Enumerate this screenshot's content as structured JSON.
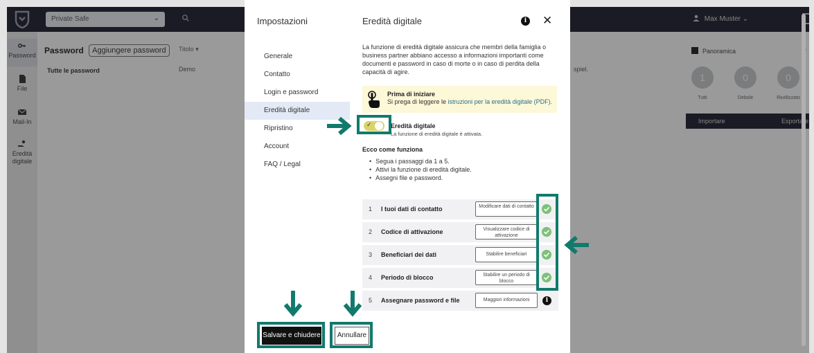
{
  "app": {
    "safe_selector": "Private Safe",
    "user_name": "Max Muster",
    "nav": [
      {
        "label": "Password"
      },
      {
        "label": "File"
      },
      {
        "label": "Mail-In"
      },
      {
        "label": "Eredità digitale"
      }
    ],
    "list_title": "Password",
    "add_password_label": "Aggiungere password",
    "all_passwords_label": "Tutte le password",
    "column_title": "Titolo",
    "row_title": "Demo",
    "row_note_fragment": "spiel.",
    "overview": {
      "title": "Panoramica",
      "more": "»",
      "counts": [
        {
          "value": "1",
          "label": "Tutti"
        },
        {
          "value": "0",
          "label": "Debole"
        },
        {
          "value": "0",
          "label": "Riutilizzato"
        }
      ],
      "import_label": "Importare",
      "export_label": "Esportare"
    }
  },
  "modal": {
    "left_title": "Impostazioni",
    "menu": [
      {
        "label": "Generale",
        "active": false
      },
      {
        "label": "Contatto",
        "active": false
      },
      {
        "label": "Login e password",
        "active": false
      },
      {
        "label": "Eredità digitale",
        "active": true
      },
      {
        "label": "Ripristino",
        "active": false
      },
      {
        "label": "Account",
        "active": false
      },
      {
        "label": "FAQ / Legal",
        "active": false
      }
    ],
    "right_title": "Eredità digitale",
    "info_glyph": "i",
    "close_glyph": "✕",
    "intro": "La funzione di eredità digitale assicura che membri della famiglia o business partner abbiano accesso a informazioni importanti come documenti e password in caso di morte o in caso di perdita della capacità di agire.",
    "prima": {
      "title": "Prima di iniziare",
      "text_before": "Si prega di leggere le ",
      "link": "istruzioni per la eredità digitale (PDF).",
      "icon": "hand-pointer-icon"
    },
    "toggle": {
      "title": "Eredità digitale",
      "subtitle": "La funzione di eredità digitale è attivata.",
      "state": "on",
      "check": "✓"
    },
    "how_title": "Ecco come funziona",
    "bullets": [
      "Segua i passaggi da 1 a 5.",
      "Attivi la funzione di eredità digitale.",
      "Assegni file e password."
    ],
    "steps": [
      {
        "num": "1",
        "label": "I tuoi dati di contatto",
        "button": "Modificare dati di contatto",
        "status": "done"
      },
      {
        "num": "2",
        "label": "Codice di attivazione",
        "button": "Visualizzare codice di attivazione",
        "status": "done"
      },
      {
        "num": "3",
        "label": "Beneficiari dei dati",
        "button": "Stabilire beneficiari",
        "status": "done"
      },
      {
        "num": "4",
        "label": "Periodo di blocco",
        "button": "Stabilire un periodo di blocco",
        "status": "done"
      },
      {
        "num": "5",
        "label": "Assegnare password e file",
        "button": "Maggiori informazioni",
        "status": "info"
      }
    ],
    "save_label": "Salvare e chiudere",
    "cancel_label": "Annullare"
  },
  "colors": {
    "highlight": "#117a6c",
    "toggle_on": "#d8d36a",
    "check_green": "#7cc27a",
    "topbar": "#1f2130",
    "notice_bg": "#fcf8d8"
  }
}
